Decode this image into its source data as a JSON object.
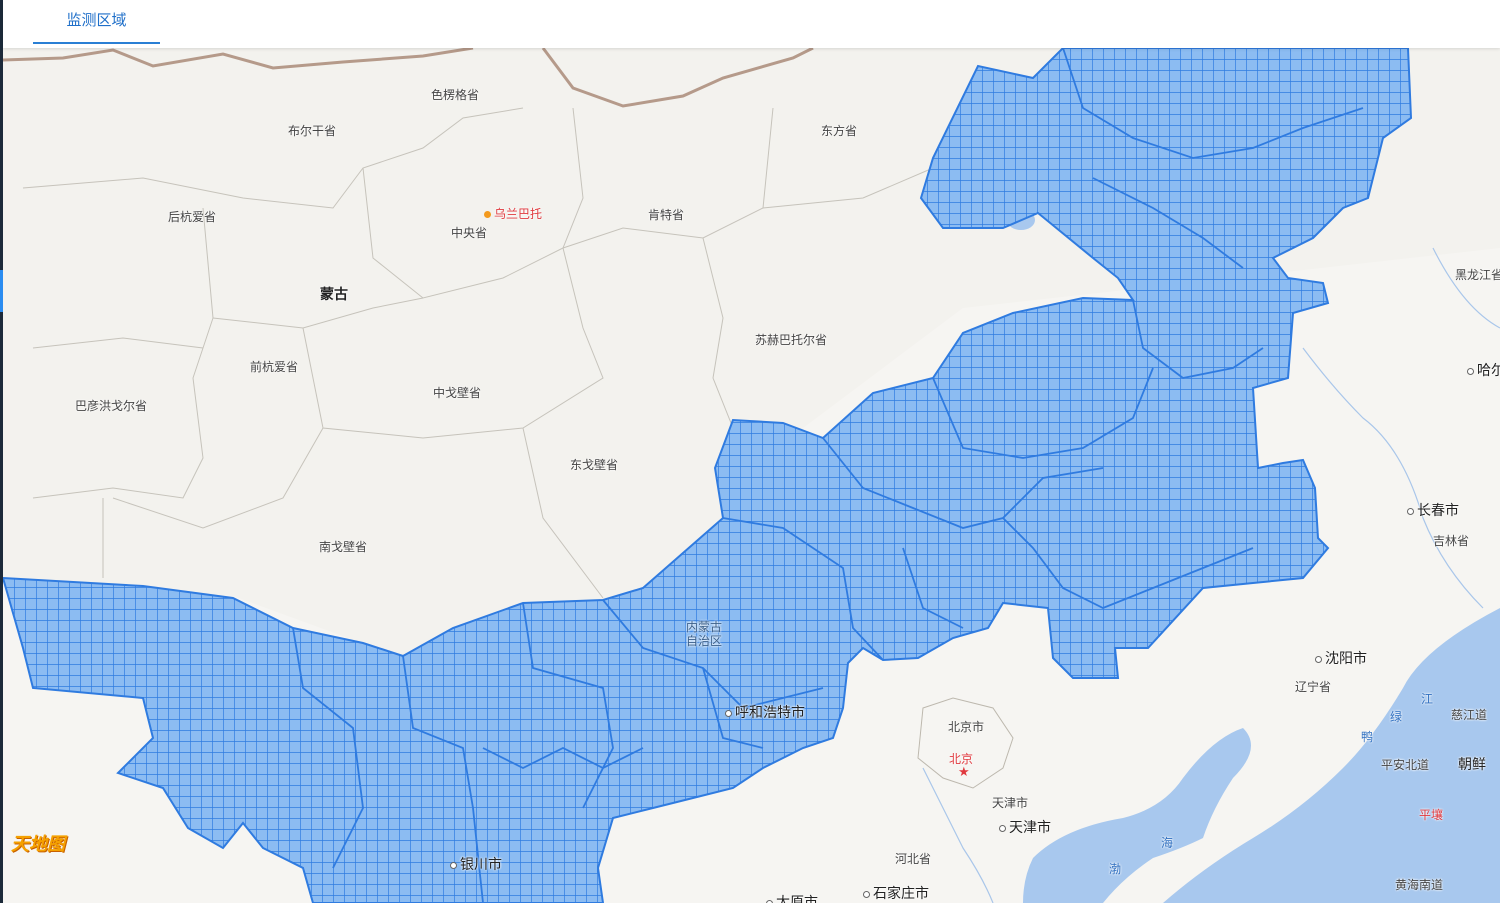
{
  "tab": {
    "label": "监测区域"
  },
  "map": {
    "logo_text": "天地图",
    "labels": {
      "selenge": "色楞格省",
      "bulgan": "布尔干省",
      "dornod": "东方省",
      "arkhangai": "后杭爱省",
      "ulaanbaatar": "乌兰巴托",
      "tov": "中央省",
      "khentii": "肯特省",
      "mongolia": "蒙古",
      "sukhbaatar": "苏赫巴托尔省",
      "uvurkhangai": "前杭爱省",
      "bayankhongor": "巴彦洪戈尔省",
      "dundgovi": "中戈壁省",
      "dornogovi": "东戈壁省",
      "umnugovi": "南戈壁省",
      "heilongjiang": "黑龙江省",
      "harbin": "哈尔",
      "changchun": "长春市",
      "jilin": "吉林省",
      "inner_mongolia_1": "内蒙古",
      "inner_mongolia_2": "自治区",
      "hohhot": "呼和浩特市",
      "shenyang": "沈阳市",
      "liaoning": "辽宁省",
      "beijing_city": "北京市",
      "beijing": "北京",
      "tianjin_city_small": "天津市",
      "tianjin": "天津市",
      "hebei": "河北省",
      "shijiazhuang": "石家庄市",
      "taiyuan": "太原市",
      "yinchuan": "银川市",
      "sea_1": "海",
      "sea_2": "渤",
      "jiang": "江",
      "lu": "绿",
      "ya": "鸭",
      "cijiang": "慈江道",
      "pyongan_north": "平安北道",
      "north_korea": "朝鲜",
      "pyongyang": "平壤",
      "hwanghae_south": "黄海南道"
    }
  },
  "colors": {
    "region_fill": "#8cbcf2",
    "region_stroke": "#2f7be0",
    "water": "#a8c8ee",
    "land": "#f3f2ee"
  }
}
